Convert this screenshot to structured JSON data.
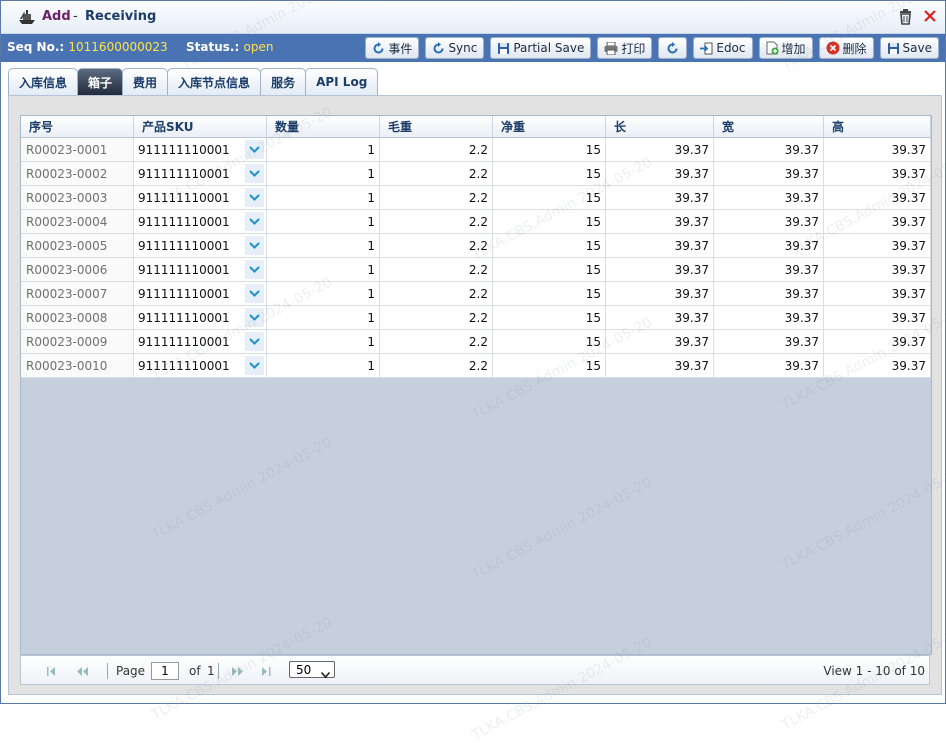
{
  "window": {
    "title_action": "Add",
    "title_separator": "-",
    "title_name": "Receiving"
  },
  "toolbar": {
    "seq_label": "Seq No.:",
    "seq_value": "1011600000023",
    "status_label": "Status.:",
    "status_value": "open",
    "buttons": {
      "events": "事件",
      "sync": "Sync",
      "partial_save": "Partial Save",
      "print": "打印",
      "edoc": "Edoc",
      "add": "增加",
      "delete": "删除",
      "save": "Save"
    }
  },
  "tabs": [
    "入库信息",
    "箱子",
    "费用",
    "入库节点信息",
    "服务",
    "API Log"
  ],
  "grid": {
    "columns": [
      "序号",
      "产品SKU",
      "数量",
      "毛重",
      "净重",
      "长",
      "宽",
      "高"
    ],
    "rows": [
      [
        "R00023-0001",
        "911111110001",
        "1",
        "2.2",
        "15",
        "39.37",
        "39.37",
        "39.37"
      ],
      [
        "R00023-0002",
        "911111110001",
        "1",
        "2.2",
        "15",
        "39.37",
        "39.37",
        "39.37"
      ],
      [
        "R00023-0003",
        "911111110001",
        "1",
        "2.2",
        "15",
        "39.37",
        "39.37",
        "39.37"
      ],
      [
        "R00023-0004",
        "911111110001",
        "1",
        "2.2",
        "15",
        "39.37",
        "39.37",
        "39.37"
      ],
      [
        "R00023-0005",
        "911111110001",
        "1",
        "2.2",
        "15",
        "39.37",
        "39.37",
        "39.37"
      ],
      [
        "R00023-0006",
        "911111110001",
        "1",
        "2.2",
        "15",
        "39.37",
        "39.37",
        "39.37"
      ],
      [
        "R00023-0007",
        "911111110001",
        "1",
        "2.2",
        "15",
        "39.37",
        "39.37",
        "39.37"
      ],
      [
        "R00023-0008",
        "911111110001",
        "1",
        "2.2",
        "15",
        "39.37",
        "39.37",
        "39.37"
      ],
      [
        "R00023-0009",
        "911111110001",
        "1",
        "2.2",
        "15",
        "39.37",
        "39.37",
        "39.37"
      ],
      [
        "R00023-0010",
        "911111110001",
        "1",
        "2.2",
        "15",
        "39.37",
        "39.37",
        "39.37"
      ]
    ]
  },
  "pager": {
    "page_label": "Page",
    "page_value": "1",
    "of_label": "of",
    "total_pages": "1",
    "page_size": "50",
    "view_text": "View  1 - 10  of  10"
  },
  "watermark": "TLKA.CBS.Admin 2024-05-20",
  "colors": {
    "toolbar_bg": "#4a73b3",
    "seq_value": "#ffe24a",
    "title_action": "#6b2266",
    "dropdown_arrow": "#1a8fd6"
  }
}
